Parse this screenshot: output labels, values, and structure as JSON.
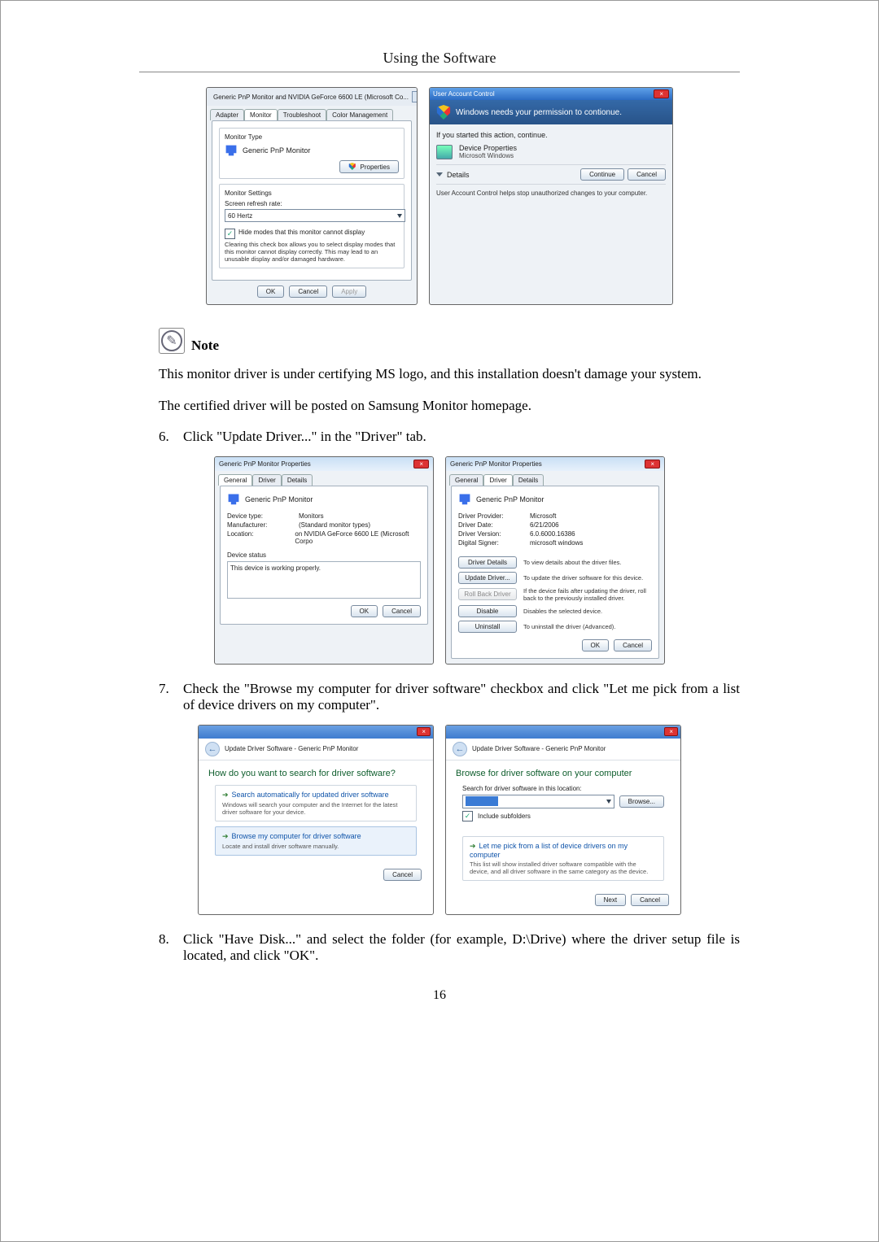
{
  "header": "Using the Software",
  "page_number": "16",
  "row1": {
    "monitor": {
      "title": "Generic PnP Monitor and NVIDIA GeForce 6600 LE (Microsoft Co...",
      "tabs": {
        "adapter": "Adapter",
        "monitor": "Monitor",
        "troubleshoot": "Troubleshoot",
        "color": "Color Management"
      },
      "group_type": "Monitor Type",
      "monitor_name": "Generic PnP Monitor",
      "properties_btn": "Properties",
      "group_settings": "Monitor Settings",
      "refresh_label": "Screen refresh rate:",
      "refresh_value": "60 Hertz",
      "hide_modes": "Hide modes that this monitor cannot display",
      "hide_modes_note": "Clearing this check box allows you to select display modes that this monitor cannot display correctly. This may lead to an unusable display and/or damaged hardware.",
      "ok": "OK",
      "cancel": "Cancel",
      "apply": "Apply"
    },
    "uac": {
      "title": "User Account Control",
      "banner": "Windows needs your permission to contionue.",
      "started": "If you started this action, continue.",
      "item_title": "Device Properties",
      "item_sub": "Microsoft Windows",
      "details": "Details",
      "continue": "Continue",
      "cancel": "Cancel",
      "footnote": "User Account Control helps stop unauthorized changes to your computer."
    }
  },
  "note_label": "Note",
  "note_body": "This monitor driver is under certifying MS logo, and this installation doesn't damage your system.",
  "note_body2": "The certified driver will be posted on Samsung Monitor homepage.",
  "step6": {
    "num": "6.",
    "text": "Click \"Update Driver...\" in the \"Driver\" tab."
  },
  "row2": {
    "left": {
      "title": "Generic PnP Monitor Properties",
      "tabs": {
        "general": "General",
        "driver": "Driver",
        "details": "Details"
      },
      "mon_name": "Generic PnP Monitor",
      "device_type_k": "Device type:",
      "device_type_v": "Monitors",
      "manufacturer_k": "Manufacturer:",
      "manufacturer_v": "(Standard monitor types)",
      "location_k": "Location:",
      "location_v": "on NVIDIA GeForce 6600 LE (Microsoft Corpo",
      "status_label": "Device status",
      "status_text": "This device is working properly.",
      "ok": "OK",
      "cancel": "Cancel"
    },
    "right": {
      "title": "Generic PnP Monitor Properties",
      "tabs": {
        "general": "General",
        "driver": "Driver",
        "details": "Details"
      },
      "mon_name": "Generic PnP Monitor",
      "provider_k": "Driver Provider:",
      "provider_v": "Microsoft",
      "date_k": "Driver Date:",
      "date_v": "6/21/2006",
      "version_k": "Driver Version:",
      "version_v": "6.0.6000.16386",
      "signer_k": "Digital Signer:",
      "signer_v": "microsoft windows",
      "btn_details": "Driver Details",
      "btn_details_d": "To view details about the driver files.",
      "btn_update": "Update Driver...",
      "btn_update_d": "To update the driver software for this device.",
      "btn_roll": "Roll Back Driver",
      "btn_roll_d": "If the device fails after updating the driver, roll back to the previously installed driver.",
      "btn_disable": "Disable",
      "btn_disable_d": "Disables the selected device.",
      "btn_uninstall": "Uninstall",
      "btn_uninstall_d": "To uninstall the driver (Advanced).",
      "ok": "OK",
      "cancel": "Cancel"
    }
  },
  "step7": {
    "num": "7.",
    "text": "Check the \"Browse my computer for driver software\" checkbox and click \"Let me pick from a list of device drivers on my computer\"."
  },
  "row3": {
    "crumb": "Update Driver Software - Generic PnP Monitor",
    "left": {
      "heading": "How do you want to search for driver software?",
      "opt1_lead": "Search automatically for updated driver software",
      "opt1_sub": "Windows will search your computer and the Internet for the latest driver software for your device.",
      "opt2_lead": "Browse my computer for driver software",
      "opt2_sub": "Locate and install driver software manually.",
      "cancel": "Cancel"
    },
    "right": {
      "heading": "Browse for driver software on your computer",
      "search_label": "Search for driver software in this location:",
      "browse_btn": "Browse...",
      "include_sub": "Include subfolders",
      "opt_lead": "Let me pick from a list of device drivers on my computer",
      "opt_sub": "This list will show installed driver software compatible with the device, and all driver software in the same category as the device.",
      "next": "Next",
      "cancel": "Cancel"
    }
  },
  "step8": {
    "num": "8.",
    "text": "Click \"Have Disk...\" and select the folder (for example, D:\\Drive) where the driver setup file is located, and click \"OK\"."
  }
}
